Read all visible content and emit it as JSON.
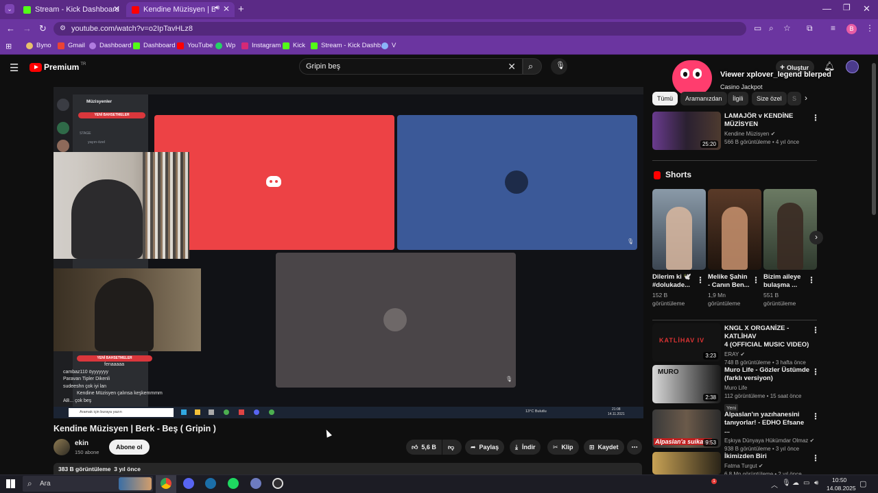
{
  "browser": {
    "tabs": [
      {
        "label": "Stream - Kick Dashboard",
        "active": false
      },
      {
        "label": "Kendine Müzisyen | Berk - B",
        "active": true
      }
    ],
    "url": "youtube.com/watch?v=o2IpTavHLz8",
    "bookmarks": [
      "Byno",
      "Gmail",
      "Dashboard",
      "Dashboard",
      "YouTube",
      "Wp",
      "Instagram",
      "Kick",
      "Stream - Kick Dashb...",
      "V"
    ],
    "profile_initial": "B"
  },
  "youtube": {
    "logo_text": "Premium",
    "logo_region": "TR",
    "search_query": "Gripin beş",
    "create_label": "Oluştur"
  },
  "overlay": {
    "alert_text": "Viewer xplover_legend blerped",
    "alert_sub": "Casino Jackpot"
  },
  "video": {
    "title": "Kendine Müzisyen | Berk - Beş ( Gripin )",
    "channel": "ekin",
    "subscribers": "150 abone",
    "subscribe_label": "Abone ol",
    "likes": "5,6 B",
    "share_label": "Paylaş",
    "download_label": "İndir",
    "clip_label": "Klip",
    "save_label": "Kaydet",
    "description_meta": "383 B görüntüleme  3 yıl önce"
  },
  "discord": {
    "server": "Müzisyenler",
    "banner": "YENİ BAHSETMELER",
    "stage_label": "STAGE",
    "channel": "yayın-özel",
    "chat_lines": [
      "fenaaaaa",
      "cambaz110 öyyyyyyy",
      "Paravan Tipler Dikenli",
      "sudeeshn çok iyi lan",
      "Kendine Müzisyen çalınsa keşkemmmm",
      "AB... çok beş"
    ],
    "taskbar_search": "Aramak için buraya yazın",
    "weather": "13°C  Bulutlu",
    "clock": "21:08",
    "date": "14.11.2021"
  },
  "chips": [
    "Tümü",
    "Aramanızdan",
    "İlgili",
    "Size özel",
    "S"
  ],
  "related": [
    {
      "title": [
        "LAMAJÖR v KENDİNE",
        "MÜZİSYEN"
      ],
      "channel": "Kendine Müzisyen",
      "verified": true,
      "meta": "566 B görüntüleme • 4 yıl önce",
      "duration": "25:20"
    },
    {
      "title": [
        "KNGL X ORGANİZE - KATLİHAV",
        "4 (OFFICIAL MUSIC VIDEO)"
      ],
      "channel": "ERAY",
      "verified": true,
      "meta": "748 B görüntüleme • 3 hafta önce",
      "duration": "3:23",
      "thumb_text": "KATLİHAV IV"
    },
    {
      "title": [
        "Muro Life - Gözler Üstümde",
        "(farklı versiyon)"
      ],
      "channel": "Muro Life",
      "verified": false,
      "meta": "112 görüntüleme • 15 saat önce",
      "badge": "Yeni",
      "duration": "2:38",
      "thumb_text": "MURO"
    },
    {
      "title": [
        "Alpaslan'ın yazıhanesini",
        "tanıyorlar! - EDHO Efsane ..."
      ],
      "channel": "Eşkıya Dünyaya Hükümdar Olmaz",
      "verified": true,
      "meta": "938 B görüntüleme • 3 yıl önce",
      "duration": "9:53",
      "thumb_text": "Alpaslan'a suikast!"
    },
    {
      "title": [
        "İkimizden Biri"
      ],
      "channel": "Fatma Turgut",
      "verified": true,
      "meta": "6.8 Mn görüntüleme • 2 yıl önce",
      "duration": ""
    }
  ],
  "shorts": {
    "heading": "Shorts",
    "items": [
      {
        "title": [
          "Dilerim ki 🕊️",
          "#dolukade..."
        ],
        "views": [
          "152 B",
          "görüntüleme"
        ]
      },
      {
        "title": [
          "Melike Şahin",
          "- Canın Ben..."
        ],
        "views": [
          "1,9 Mn",
          "görüntüleme"
        ]
      },
      {
        "title": [
          "Bizim aileye",
          "bulaşma ..."
        ],
        "views": [
          "551 B",
          "görüntüleme"
        ]
      }
    ]
  },
  "taskbar": {
    "search_label": "Ara",
    "time": "10:50",
    "date": "14.08.2025",
    "notification_count": "1"
  },
  "colors": {
    "chrome_purple": "#6b35a0",
    "discord_red": "#ed4245",
    "discord_blue": "#3b5998",
    "yt_red": "#ff0000"
  }
}
